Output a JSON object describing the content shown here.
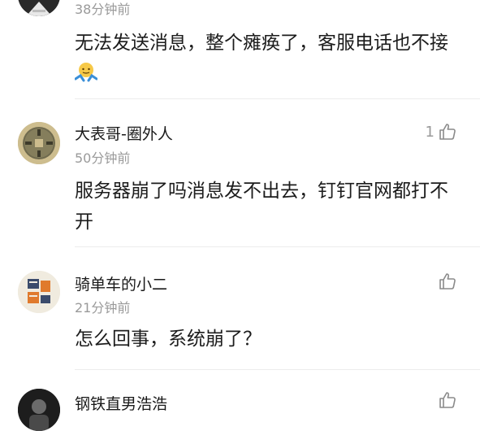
{
  "comments": [
    {
      "time": "38分钟前",
      "text": "无法发送消息，整个瘫痪了，客服电话也不接",
      "emoji": "shrugging-face-emoji"
    },
    {
      "name": "大表哥-圈外人",
      "time": "50分钟前",
      "text": "服务器崩了吗消息发不出去，钉钉官网都打不开",
      "likes": "1",
      "avatar": "old-coin-avatar"
    },
    {
      "name": "骑单车的小二",
      "time": "21分钟前",
      "text": "怎么回事，系统崩了？",
      "avatar": "power-people-avatar"
    },
    {
      "name": "钢铁直男浩浩",
      "avatar": "dark-figure-avatar"
    }
  ],
  "icons": {
    "like": "thumbs-up-icon"
  },
  "colors": {
    "secondary_text": "#9a9a9a",
    "divider": "#ececec"
  }
}
